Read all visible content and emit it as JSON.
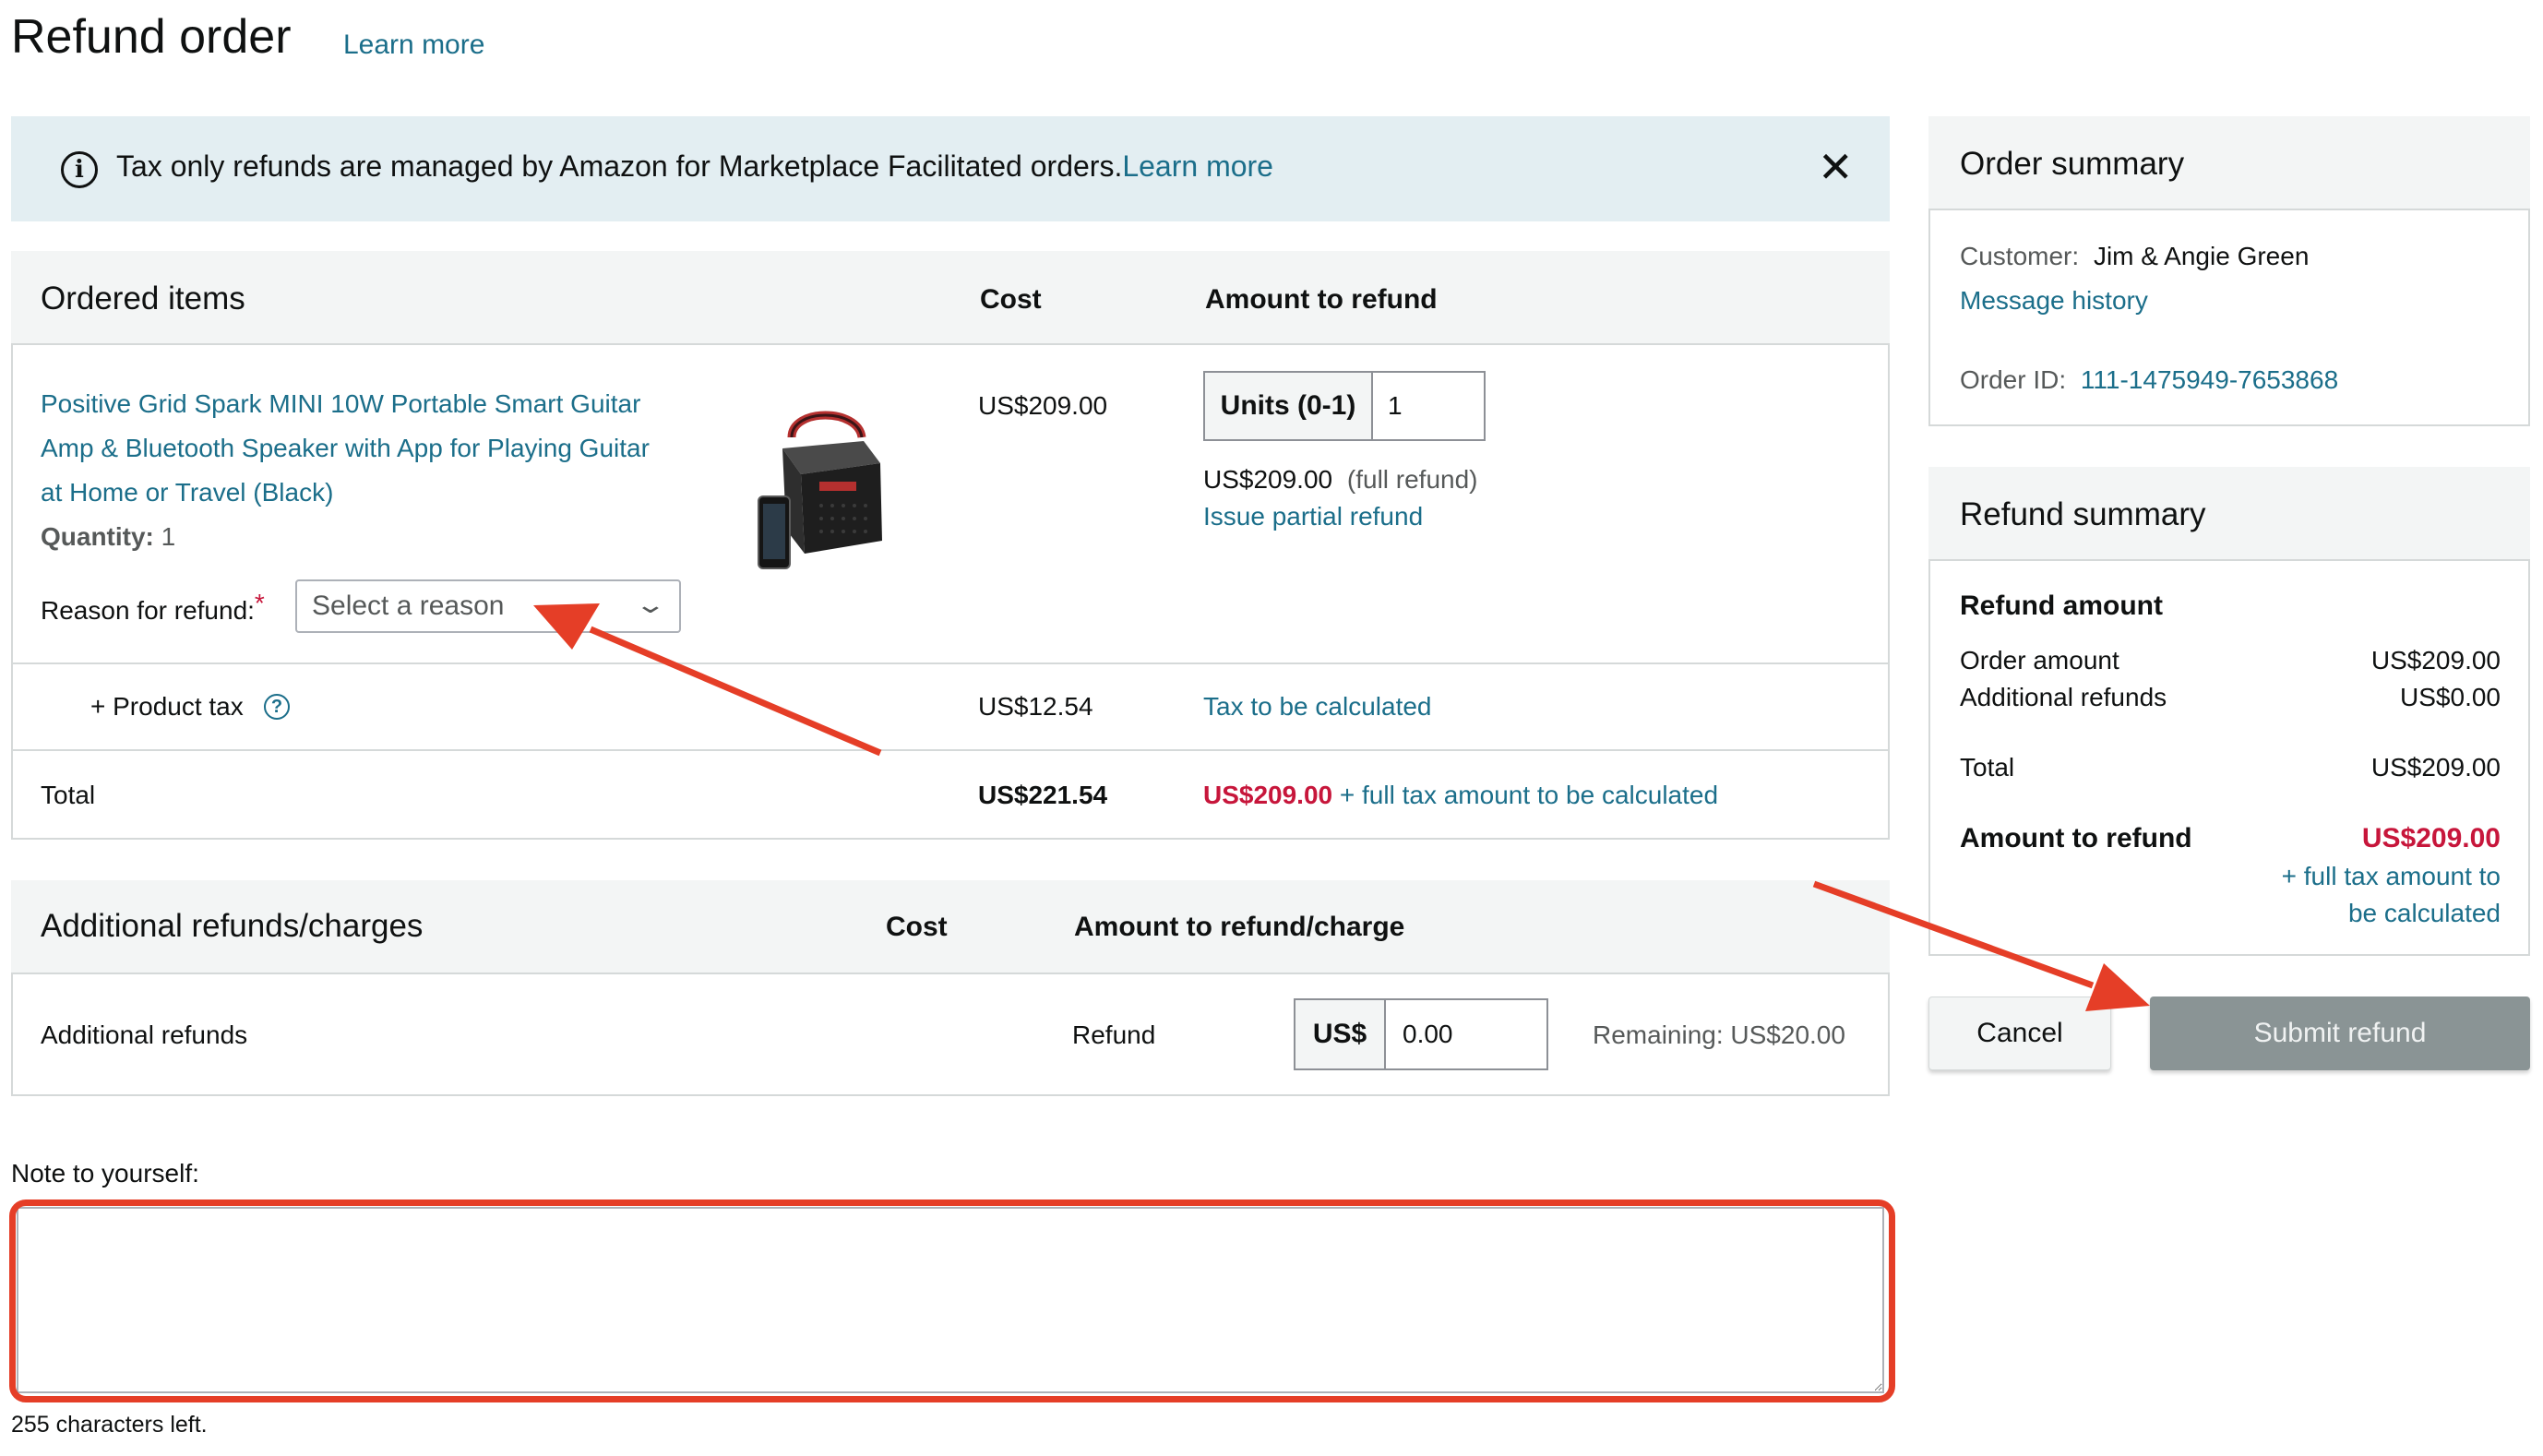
{
  "header": {
    "title": "Refund order",
    "learn_more": "Learn more"
  },
  "alert": {
    "text": "Tax only refunds are managed by Amazon for Marketplace Facilitated orders.",
    "link": "Learn more",
    "info_icon": "info-icon",
    "close_icon": "close-icon"
  },
  "ordered_items": {
    "heading": "Ordered items",
    "col_cost": "Cost",
    "col_amount": "Amount to refund",
    "product": {
      "title_lines": [
        "Positive Grid Spark MINI 10W Portable Smart Guitar",
        "Amp & Bluetooth Speaker with App for Playing Guitar",
        "at Home or Travel (Black)"
      ],
      "quantity_label": "Quantity:",
      "quantity_value": "1",
      "cost": "US$209.00",
      "units_label": "Units (0-1)",
      "units_value": "1",
      "refund_amount": "US$209.00",
      "refund_note": "(full refund)",
      "partial_link": "Issue partial refund"
    },
    "reason_label": "Reason for refund:",
    "reason_required": "*",
    "reason_placeholder": "Select a reason",
    "tax_label": "+ Product tax",
    "tax_cost": "US$12.54",
    "tax_refund": "Tax to be calculated",
    "total_label": "Total",
    "total_cost": "US$221.54",
    "total_refund_amount": "US$209.00",
    "total_refund_note": "+ full tax amount to be calculated"
  },
  "additional": {
    "heading": "Additional refunds/charges",
    "col_cost": "Cost",
    "col_amount": "Amount to refund/charge",
    "row_label": "Additional refunds",
    "type": "Refund",
    "currency": "US$",
    "value": "0.00",
    "remaining": "Remaining: US$20.00"
  },
  "note": {
    "label": "Note to yourself:",
    "value": "",
    "chars_left": "255 characters left."
  },
  "order_summary": {
    "heading": "Order summary",
    "customer_label": "Customer:",
    "customer_name": "Jim & Angie Green",
    "message_history": "Message history",
    "order_id_label": "Order ID:",
    "order_id": "111-1475949-7653868"
  },
  "refund_summary": {
    "heading": "Refund summary",
    "amount_heading": "Refund amount",
    "order_amount_label": "Order amount",
    "order_amount": "US$209.00",
    "additional_label": "Additional refunds",
    "additional_amount": "US$0.00",
    "total_label": "Total",
    "total_amount": "US$209.00",
    "to_refund_label": "Amount to refund",
    "to_refund_amount": "US$209.00",
    "tax_note_line1": "+ full tax amount to",
    "tax_note_line2": "be calculated"
  },
  "actions": {
    "cancel": "Cancel",
    "submit": "Submit refund"
  },
  "colors": {
    "link": "#1b6e8a",
    "alert_bg": "#e3eef2",
    "refund_red": "#c7163b",
    "annotation_red": "#e53e27",
    "submit_disabled": "#8a9495"
  }
}
